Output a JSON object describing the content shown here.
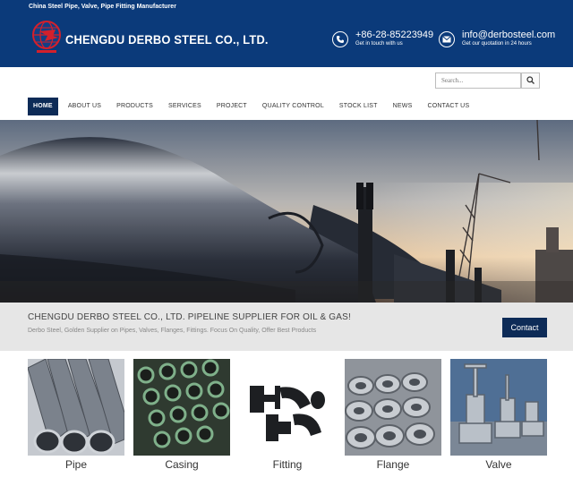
{
  "header": {
    "tagline": "China Steel Pipe, Valve, Pipe Fitting Manufacturer",
    "brand": "CHENGDU DERBO STEEL CO., LTD.",
    "logo_icon": "globe-logo-icon",
    "phone": "+86-28-85223949",
    "phone_sub": "Get in touch with us",
    "email": "info@derbosteel.com",
    "email_sub": "Get our quotation in 24 hours",
    "brand_color": "#0b3a7a",
    "accent_color": "#d4202b"
  },
  "search": {
    "placeholder": "Search...",
    "button_icon": "search-icon"
  },
  "nav": {
    "items": [
      {
        "label": "HOME",
        "active": true
      },
      {
        "label": "ABOUT US"
      },
      {
        "label": "PRODUCTS"
      },
      {
        "label": "SERVICES"
      },
      {
        "label": "PROJECT"
      },
      {
        "label": "QUALITY CONTROL"
      },
      {
        "label": "STOCK LIST"
      },
      {
        "label": "NEWS"
      },
      {
        "label": "CONTACT US"
      }
    ],
    "active_color": "#0d2b57"
  },
  "banner": {
    "title": "CHENGDU DERBO STEEL CO., LTD. PIPELINE SUPPLIER FOR OIL & GAS!",
    "subtitle": "Derbo Steel, Golden Supplier on Pipes, Valves, Flanges, Fittings. Focus On Quality, Offer Best Products",
    "button": "Contact"
  },
  "products": [
    {
      "label": "Pipe"
    },
    {
      "label": "Casing"
    },
    {
      "label": "Fitting"
    },
    {
      "label": "Flange"
    },
    {
      "label": "Valve"
    }
  ]
}
